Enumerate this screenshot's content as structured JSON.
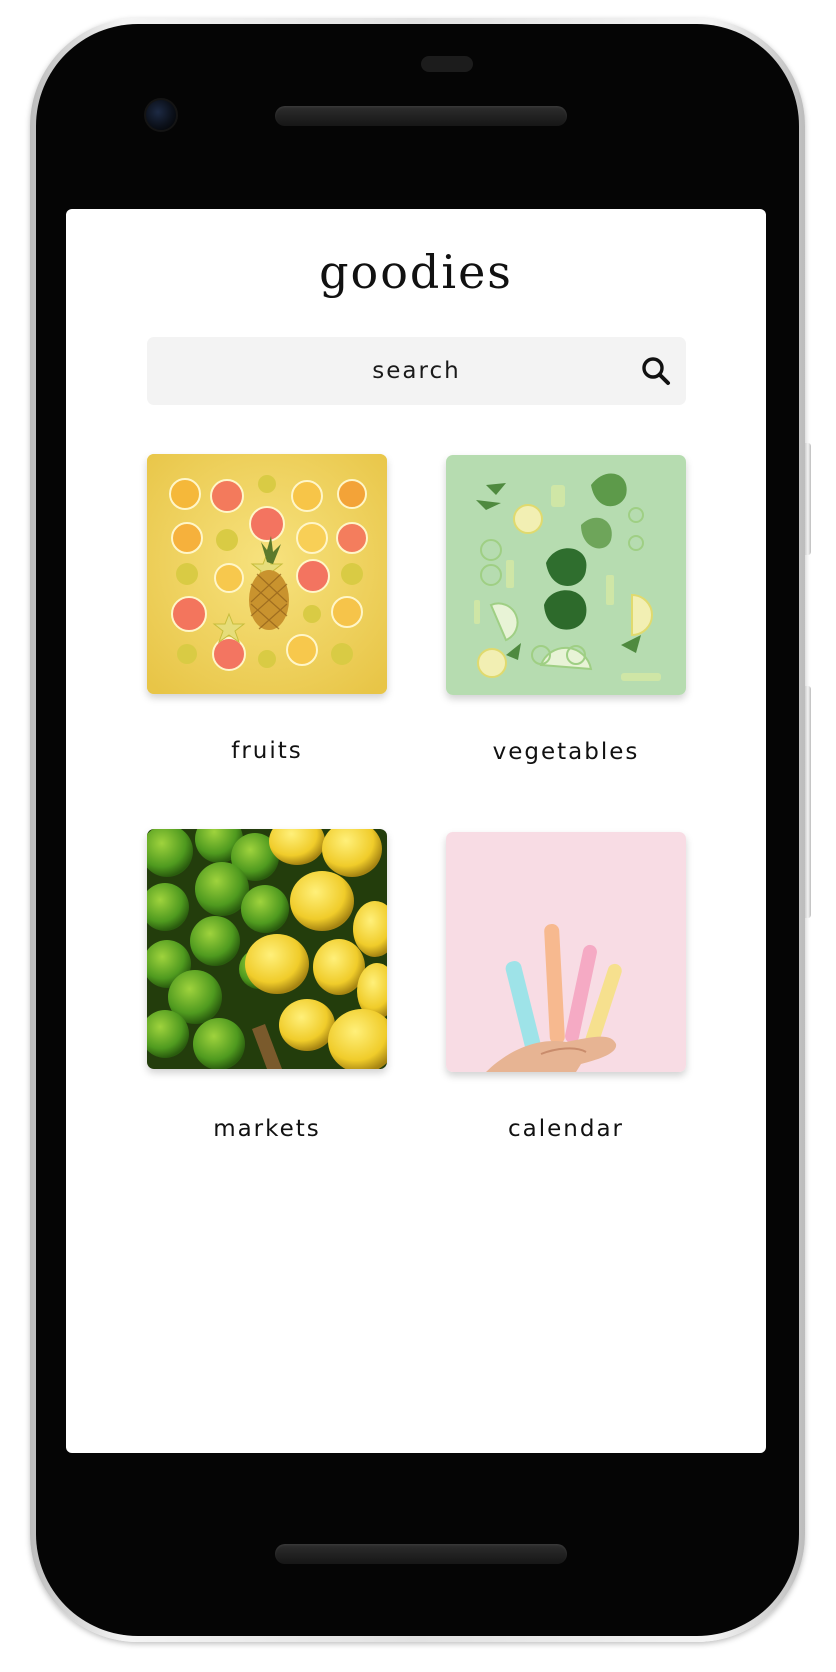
{
  "app": {
    "title": "goodies"
  },
  "search": {
    "placeholder": "search",
    "value": ""
  },
  "categories": [
    {
      "label": "fruits",
      "image": "citrus-pineapple-flatlay"
    },
    {
      "label": "vegetables",
      "image": "green-vegetables-flatlay"
    },
    {
      "label": "markets",
      "image": "limes-lemons-pile"
    },
    {
      "label": "calendar",
      "image": "pastel-highlighters-hand"
    }
  ],
  "colors": {
    "background": "#ffffff",
    "search_bg": "#f3f3f3",
    "text": "#111111",
    "phone_bezel": "#050505"
  },
  "icons": {
    "search": "search-icon"
  }
}
